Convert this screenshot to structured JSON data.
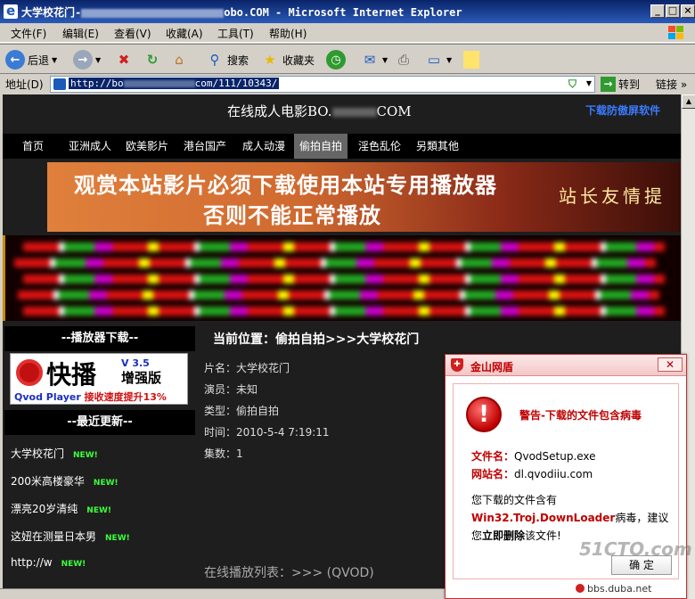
{
  "window": {
    "title_prefix": "大学校花门-",
    "title_suffix": "obo.COM - Microsoft Internet Explorer"
  },
  "menu": [
    "文件(F)",
    "编辑(E)",
    "查看(V)",
    "收藏(A)",
    "工具(T)",
    "帮助(H)"
  ],
  "toolbar": {
    "back": "后退",
    "search": "搜索",
    "favorites": "收藏夹"
  },
  "address": {
    "label": "地址(D)",
    "url_prefix": "http://bo",
    "url_suffix": "com/111/10343/",
    "go": "转到",
    "links": "链接"
  },
  "site": {
    "title_prefix": "在线成人电影BO.",
    "title_suffix": "COM",
    "download_link": "下载防傲屏软件",
    "nav": [
      "首页",
      "亚洲成人",
      "欧美影片",
      "港台国产",
      "成人动漫",
      "偷拍自拍",
      "淫色乱伦",
      "另類其他"
    ],
    "nav_active": "偷拍自拍",
    "banner_line1": "观赏本站影片必须下载使用本站专用播放器",
    "banner_line2": "否则不能正常播放",
    "banner_tip": "站长友情提",
    "player_header": "--播放器下载--",
    "qvod_brand": "快播",
    "qvod_version": "V 3.5",
    "qvod_edition": "增强版",
    "qvod_sub": "Qvod Player",
    "qvod_sub_red": "接收速度提升13%",
    "updates_header": "--最近更新--",
    "updates": [
      "大学校花门",
      "200米高楼豪华",
      "漂亮20岁清纯",
      "这妞在测量日本男",
      "http://w"
    ],
    "new_tag": "NEW!",
    "breadcrumb": "当前位置：偷拍自拍>>>大学校花门",
    "info": {
      "name": "片名：大学校花门",
      "actor": "演员：未知",
      "type": "类型：偷拍自拍",
      "time": "时间：2010-5-4 7:19:11",
      "episodes": "集数：1"
    },
    "playlist": "在线播放列表：>>> (QVOD)"
  },
  "popup": {
    "title": "金山网盾",
    "close": "✕",
    "warning": "警告-下载的文件包含病毒",
    "file_label": "文件名：",
    "file_name": "QvodSetup.exe",
    "site_label": "网站名：",
    "site_name": "dl.qvodiiu.com",
    "msg_prefix": "您下载的文件含有",
    "virus_name": "Win32.Troj.DownLoader",
    "msg_suffix": "病毒，建议您",
    "msg_action": "立即删除",
    "msg_end": "该文件!",
    "ok": "确 定",
    "footer": "bbs.duba.net"
  },
  "watermark": "51CTO.com"
}
